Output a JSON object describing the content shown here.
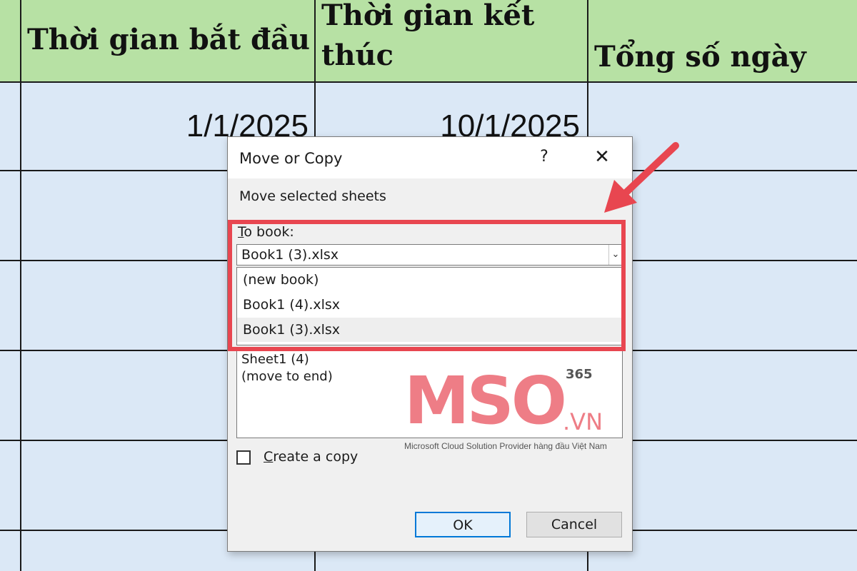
{
  "spreadsheet": {
    "headers": [
      "Thời gian bắt đầu",
      "Thời gian kết thúc",
      "Tổng số ngày"
    ],
    "row1": {
      "start": "1/1/2025",
      "end": "10/1/2025"
    }
  },
  "dialog": {
    "title": "Move or Copy",
    "help_label": "?",
    "close_label": "✕",
    "subtitle": "Move selected sheets",
    "to_book_label_first": "T",
    "to_book_label_rest": "o book:",
    "combo_value": "Book1 (3).xlsx",
    "dropdown_options": [
      "(new book)",
      "Book1 (4).xlsx",
      "Book1 (3).xlsx"
    ],
    "selected_option": "Book1 (3).xlsx",
    "sheet_list": [
      "Sheet1 (4)",
      "(move to end)"
    ],
    "create_copy_first": "C",
    "create_copy_rest": "reate a copy",
    "create_copy_checked": false,
    "ok_label": "OK",
    "cancel_label": "Cancel"
  },
  "watermark": {
    "letters": "MSO",
    "superscript": "365",
    "suffix": ".VN",
    "tagline": "Microsoft Cloud Solution Provider hàng đầu Việt Nam"
  },
  "colors": {
    "header_fill": "#b7e1a4",
    "cell_fill": "#dbe8f6",
    "highlight": "#e84650",
    "accent": "#0078d7",
    "logo": "#ee7d86"
  },
  "icons": {
    "dropdown": "chevron-down-icon",
    "arrow": "red-pointer-arrow-icon"
  }
}
